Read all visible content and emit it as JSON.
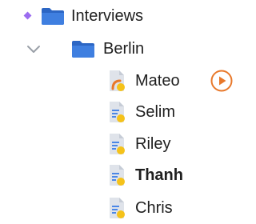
{
  "colors": {
    "accent": "#9b6cf0",
    "folder": "#3f7fe0",
    "folder_tab": "#2c66c4",
    "doc_page": "#dfe3ea",
    "doc_fold": "#c6ccd6",
    "doc_lines": "#4c87e6",
    "status_dot": "#f5c21a",
    "recording_icon": "#e8782a",
    "play_button": "#e8782a",
    "chevron": "#9aa0a8"
  },
  "tree": {
    "root": {
      "label": "Interviews",
      "icon": "folder-icon",
      "marker": "diamond-marker"
    },
    "folder": {
      "label": "Berlin",
      "icon": "folder-icon",
      "expanded": true
    },
    "items": [
      {
        "label": "Mateo",
        "icon": "audio-transcript-icon",
        "action": "play-icon",
        "selected": false
      },
      {
        "label": "Selim",
        "icon": "transcript-icon",
        "selected": false
      },
      {
        "label": "Riley",
        "icon": "transcript-icon",
        "selected": false
      },
      {
        "label": "Thanh",
        "icon": "transcript-icon",
        "selected": true
      },
      {
        "label": "Chris",
        "icon": "transcript-icon",
        "selected": false
      }
    ]
  }
}
